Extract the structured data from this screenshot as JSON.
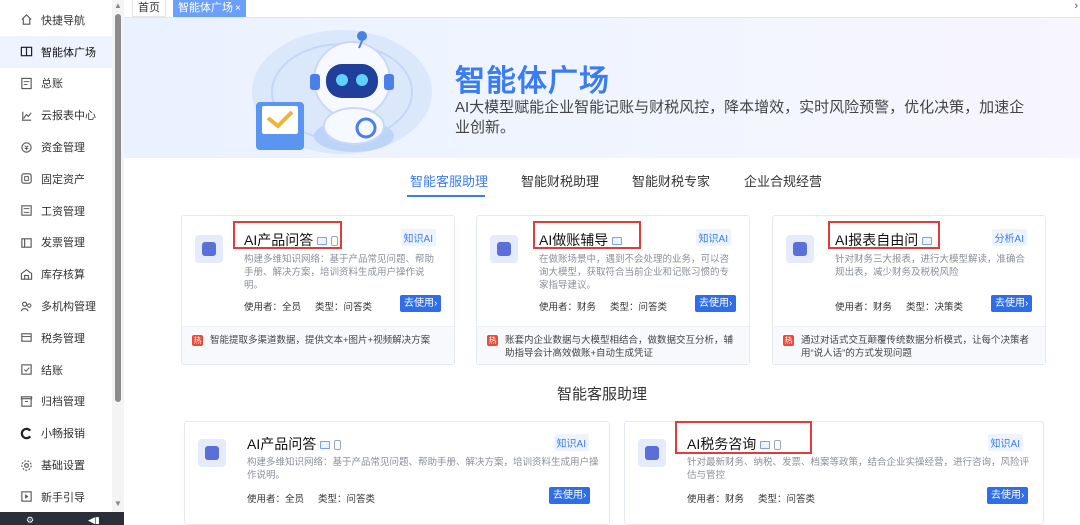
{
  "sidebar": {
    "items": [
      {
        "label": "快捷导航",
        "icon": "home-icon"
      },
      {
        "label": "智能体广场",
        "icon": "book-icon",
        "active": true
      },
      {
        "label": "总账",
        "icon": "ledger-icon"
      },
      {
        "label": "云报表中心",
        "icon": "chart-icon"
      },
      {
        "label": "资金管理",
        "icon": "money-icon"
      },
      {
        "label": "固定资产",
        "icon": "asset-icon"
      },
      {
        "label": "工资管理",
        "icon": "salary-icon"
      },
      {
        "label": "发票管理",
        "icon": "invoice-icon"
      },
      {
        "label": "库存核算",
        "icon": "warehouse-icon"
      },
      {
        "label": "多机构管理",
        "icon": "org-icon"
      },
      {
        "label": "税务管理",
        "icon": "tax-icon"
      },
      {
        "label": "结账",
        "icon": "close-book-icon"
      },
      {
        "label": "归档管理",
        "icon": "archive-icon"
      },
      {
        "label": "小畅报销",
        "icon": "reimburse-icon"
      },
      {
        "label": "基础设置",
        "icon": "gear-icon"
      },
      {
        "label": "新手引导",
        "icon": "guide-icon"
      }
    ]
  },
  "tabs": {
    "home": "首页",
    "active": "智能体广场",
    "close_glyph": "×"
  },
  "hero": {
    "title": "智能体广场",
    "desc": "AI大模型赋能企业智能记账与财税风控，降本增效，实时风险预警，优化决策，加速企业创新。"
  },
  "categories": [
    "智能客服助理",
    "智能财税助理",
    "智能财税专家",
    "企业合规经营"
  ],
  "featured": [
    {
      "title": "AI产品问答",
      "badge": "知识AI",
      "desc": "构建多维知识网络：基于产品常见问题、帮助手册、解决方案，培训资料生成用户操作说明。",
      "user_label": "使用者：全员",
      "type_label": "类型：问答类",
      "button": "去使用",
      "foot": "智能提取多渠道数据，提供文本+图片+视频解决方案",
      "hot": "热"
    },
    {
      "title": "AI做账辅导",
      "badge": "知识AI",
      "desc": "在做账场景中，遇到不会处理的业务，可以咨询大模型，获取符合当前企业和记账习惯的专家指导建议。",
      "user_label": "使用者：财务",
      "type_label": "类型：问答类",
      "button": "去使用",
      "foot": "账套内企业数据与大模型相结合，做数据交互分析，辅助指导会计高效做账+自动生成凭证",
      "hot": "热"
    },
    {
      "title": "AI报表自由问",
      "badge": "分析AI",
      "desc": "针对财务三大报表，进行大模型解读，准确合规出表，减少财务及税税风险",
      "user_label": "使用者：财务",
      "type_label": "类型：决策类",
      "button": "去使用",
      "foot": "通过对话式交互颠覆传统数据分析模式，让每个决策者用“说人话”的方式发现问题",
      "hot": "热"
    }
  ],
  "section": {
    "title": "智能客服助理"
  },
  "lower": [
    {
      "title": "AI产品问答",
      "badge": "知识AI",
      "desc": "构建多维知识网络：基于产品常见问题、帮助手册、解决方案，培训资料生成用户操作说明。",
      "user_label": "使用者：全员",
      "type_label": "类型：问答类",
      "button": "去使用"
    },
    {
      "title": "AI税务咨询",
      "badge": "知识AI",
      "desc": "针对最新财务、纳税、发票、档案等政策，结合企业实操经营，进行咨询，风险评估与管控",
      "user_label": "使用者：财务",
      "type_label": "类型：问答类",
      "button": "去使用"
    }
  ],
  "colors": {
    "accent": "#3a7cf2",
    "button": "#2f6ee8",
    "highlight_box": "#e23b3b",
    "hot": "#e94b35"
  }
}
